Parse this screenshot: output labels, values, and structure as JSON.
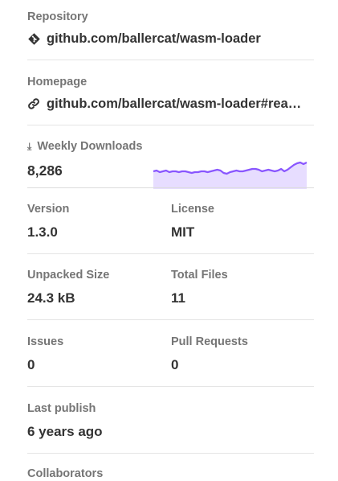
{
  "repository": {
    "label": "Repository",
    "link": "github.com/ballercat/wasm-loader",
    "icon": "git-icon"
  },
  "homepage": {
    "label": "Homepage",
    "link": "github.com/ballercat/wasm-loader#readme",
    "icon": "link-icon"
  },
  "downloads": {
    "label": "Weekly Downloads",
    "value": "8,286",
    "icon": "download-icon",
    "sparkline_color": "#8956ff",
    "sparkline_fill": "#e7ddff",
    "chart_data": {
      "type": "area",
      "values": [
        22,
        23,
        21,
        22,
        23,
        21,
        22,
        22,
        21,
        22,
        22,
        21,
        20,
        21,
        21,
        22,
        22,
        21,
        22,
        23,
        24,
        23,
        20,
        19,
        21,
        22,
        23,
        22,
        22,
        23,
        24,
        25,
        25,
        24,
        22,
        23,
        24,
        23,
        22,
        23,
        25,
        22,
        24,
        27,
        30,
        32,
        33,
        31,
        33
      ]
    }
  },
  "version": {
    "label": "Version",
    "value": "1.3.0"
  },
  "license": {
    "label": "License",
    "value": "MIT"
  },
  "unpacked_size": {
    "label": "Unpacked Size",
    "value": "24.3 kB"
  },
  "total_files": {
    "label": "Total Files",
    "value": "11"
  },
  "issues": {
    "label": "Issues",
    "value": "0"
  },
  "pull_requests": {
    "label": "Pull Requests",
    "value": "0"
  },
  "last_publish": {
    "label": "Last publish",
    "value": "6 years ago"
  },
  "collaborators": {
    "label": "Collaborators"
  }
}
